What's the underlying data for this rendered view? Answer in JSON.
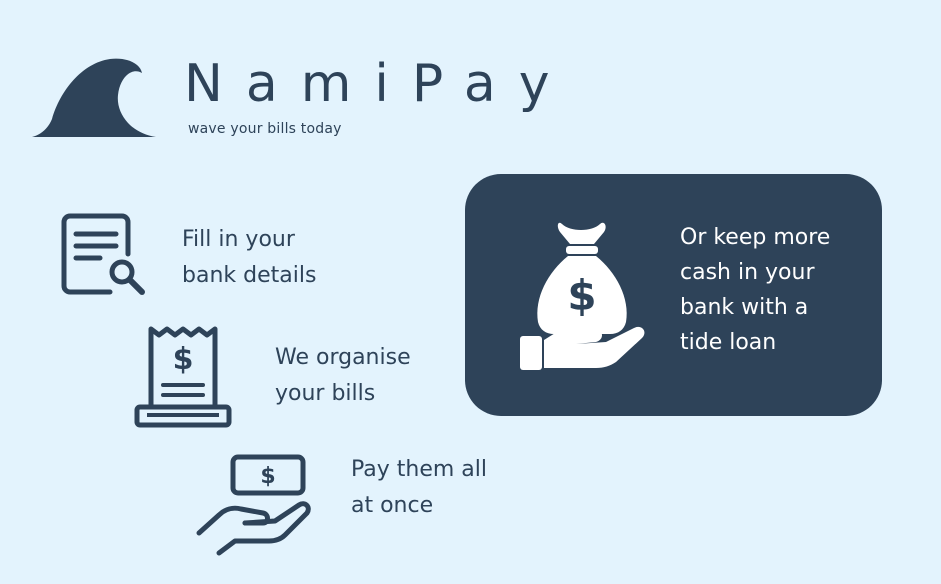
{
  "brand": {
    "name": "NamiPay",
    "tagline": "wave your bills today"
  },
  "steps": [
    {
      "icon": "document-search-icon",
      "lines": [
        "Fill in your",
        "bank details"
      ]
    },
    {
      "icon": "receipt-dollar-icon",
      "lines": [
        "We organise",
        "your bills"
      ]
    },
    {
      "icon": "hand-cash-icon",
      "lines": [
        "Pay them all",
        "at once"
      ]
    }
  ],
  "loan_card": {
    "icon": "money-bag-hand-icon",
    "lines": [
      "Or keep more",
      "cash in your",
      "bank with a",
      "tide loan"
    ]
  },
  "colors": {
    "background": "#e3f3fd",
    "navy": "#2e4359",
    "white": "#ffffff"
  }
}
